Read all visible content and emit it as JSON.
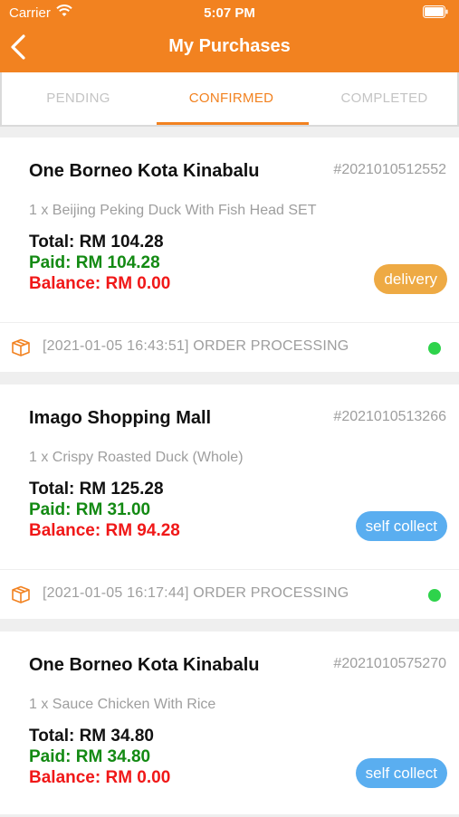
{
  "status_bar": {
    "carrier": "Carrier",
    "time": "5:07 PM"
  },
  "header": {
    "title": "My Purchases"
  },
  "tabs": [
    {
      "label": "PENDING",
      "active": false
    },
    {
      "label": "CONFIRMED",
      "active": true
    },
    {
      "label": "COMPLETED",
      "active": false
    }
  ],
  "colors": {
    "brand": "#f28220",
    "paid": "#138a13",
    "balance": "#f01818",
    "delivery_badge": "#eeaa44",
    "self_collect_badge": "#5aaef0",
    "status_dot": "#2ed34b"
  },
  "orders": [
    {
      "store": "One Borneo Kota Kinabalu",
      "order_id": "#2021010512552",
      "item": "1 x Beijing Peking Duck With Fish Head SET",
      "total": "Total: RM 104.28",
      "paid": "Paid: RM 104.28",
      "balance": "Balance: RM 0.00",
      "type": "delivery",
      "status": "[2021-01-05 16:43:51] ORDER PROCESSING"
    },
    {
      "store": "Imago Shopping Mall",
      "order_id": "#2021010513266",
      "item": "1 x Crispy Roasted Duck (Whole)",
      "total": "Total: RM 125.28",
      "paid": "Paid: RM 31.00",
      "balance": "Balance: RM 94.28",
      "type": "self collect",
      "status": "[2021-01-05 16:17:44] ORDER PROCESSING"
    },
    {
      "store": "One Borneo Kota Kinabalu",
      "order_id": "#2021010575270",
      "item": "1 x Sauce Chicken With Rice",
      "total": "Total: RM 34.80",
      "paid": "Paid: RM 34.80",
      "balance": "Balance: RM 0.00",
      "type": "self collect",
      "status": ""
    }
  ]
}
